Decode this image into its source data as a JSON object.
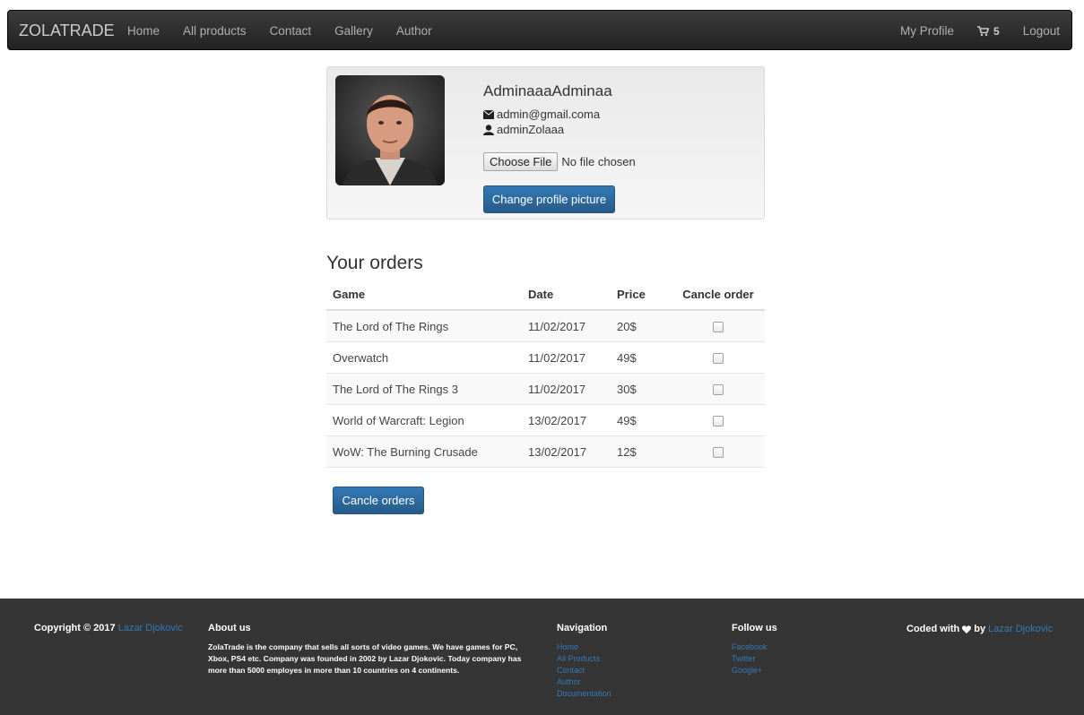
{
  "navbar": {
    "brand": "ZOLATRADE",
    "links": [
      "Home",
      "All products",
      "Contact",
      "Gallery",
      "Author"
    ],
    "profile": "My Profile",
    "cart_count": "5",
    "logout": "Logout"
  },
  "profile": {
    "name": "AdminaaaAdminaa",
    "email": "admin@gmail.coma",
    "username": "adminZolaaa",
    "choose_file": "Choose File",
    "no_file": "No file chosen",
    "change_picture": "Change profile picture"
  },
  "orders": {
    "title": "Your orders",
    "headers": [
      "Game",
      "Date",
      "Price",
      "Cancle order"
    ],
    "rows": [
      {
        "game": "The Lord of The Rings",
        "date": "11/02/2017",
        "price": "20$"
      },
      {
        "game": "Overwatch",
        "date": "11/02/2017",
        "price": "49$"
      },
      {
        "game": "The Lord of The Rings 3",
        "date": "11/02/2017",
        "price": "30$"
      },
      {
        "game": "World of Warcraft: Legion",
        "date": "13/02/2017",
        "price": "49$"
      },
      {
        "game": "WoW: The Burning Crusade",
        "date": "13/02/2017",
        "price": "12$"
      }
    ],
    "cancel_button": "Cancle orders"
  },
  "footer": {
    "copyright": "Copyright © 2017",
    "author": "Lazar Djokovic",
    "about_title": "About us",
    "about_text": "ZolaTrade is the company that sells all sorts of video games. We have games for PC, Xbox, PS4 etc. Company was founded in 2002 by Lazar Djokovic. Today company has more than 5000 employes in more than 10 countries on 4 continents.",
    "nav_title": "Navigation",
    "nav_links": [
      "Home",
      "All Products",
      "Contact",
      "Author",
      "Documentation"
    ],
    "follow_title": "Follow us",
    "follow_links": [
      "Facebook",
      "Twitter",
      "Google+"
    ],
    "coded_with": "Coded with",
    "by": "by",
    "coded_author": "Lazar Djokovic"
  }
}
